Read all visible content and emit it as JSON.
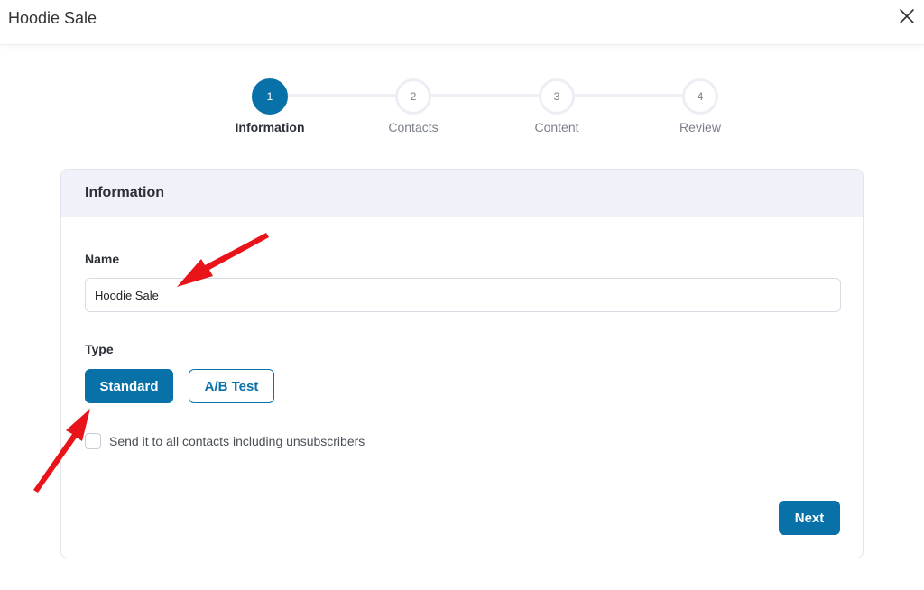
{
  "modal": {
    "title": "Hoodie Sale",
    "close_icon": "close-icon"
  },
  "stepper": {
    "steps": [
      {
        "number": "1",
        "label": "Information",
        "active": true
      },
      {
        "number": "2",
        "label": "Contacts",
        "active": false
      },
      {
        "number": "3",
        "label": "Content",
        "active": false
      },
      {
        "number": "4",
        "label": "Review",
        "active": false
      }
    ]
  },
  "card": {
    "title": "Information",
    "name_label": "Name",
    "name_value": "Hoodie Sale",
    "type_label": "Type",
    "type_options": [
      {
        "label": "Standard",
        "selected": true
      },
      {
        "label": "A/B Test",
        "selected": false
      }
    ],
    "checkbox_label": "Send it to all contacts including unsubscribers",
    "checkbox_checked": false,
    "next_label": "Next"
  },
  "colors": {
    "primary": "#0872a8",
    "header_bg": "#f0f1f9",
    "annotation_arrow": "#e8141a"
  }
}
